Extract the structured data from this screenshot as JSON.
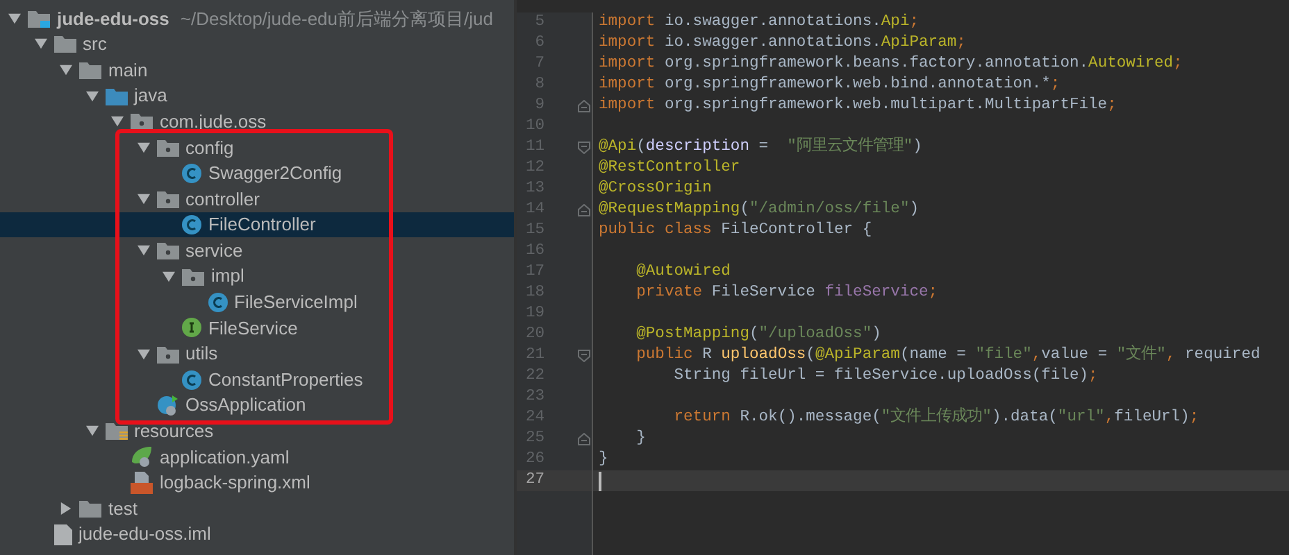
{
  "project_tree": {
    "label": "jude-edu-oss",
    "hint": "~/Desktop/jude-edu前后端分离项目/jud",
    "kind": "module-folder",
    "expanded": true,
    "selected": false,
    "children": [
      {
        "label": "src",
        "kind": "folder",
        "expanded": true,
        "selected": false,
        "children": [
          {
            "label": "main",
            "kind": "folder",
            "expanded": true,
            "selected": false,
            "children": [
              {
                "label": "java",
                "kind": "source-folder",
                "expanded": true,
                "selected": false,
                "children": [
                  {
                    "label": "com.jude.oss",
                    "kind": "package",
                    "expanded": true,
                    "selected": false,
                    "framed": true,
                    "children": [
                      {
                        "label": "config",
                        "kind": "package",
                        "expanded": true,
                        "selected": false,
                        "children": [
                          {
                            "label": "Swagger2Config",
                            "kind": "class",
                            "selected": false
                          }
                        ]
                      },
                      {
                        "label": "controller",
                        "kind": "package",
                        "expanded": true,
                        "selected": false,
                        "children": [
                          {
                            "label": "FileController",
                            "kind": "class",
                            "selected": true
                          }
                        ]
                      },
                      {
                        "label": "service",
                        "kind": "package",
                        "expanded": true,
                        "selected": false,
                        "children": [
                          {
                            "label": "impl",
                            "kind": "package",
                            "expanded": true,
                            "selected": false,
                            "children": [
                              {
                                "label": "FileServiceImpl",
                                "kind": "class",
                                "selected": false
                              }
                            ]
                          },
                          {
                            "label": "FileService",
                            "kind": "interface",
                            "selected": false
                          }
                        ]
                      },
                      {
                        "label": "utils",
                        "kind": "package",
                        "expanded": true,
                        "selected": false,
                        "children": [
                          {
                            "label": "ConstantProperties",
                            "kind": "class",
                            "selected": false
                          }
                        ]
                      },
                      {
                        "label": "OssApplication",
                        "kind": "spring-boot-class",
                        "selected": false
                      }
                    ]
                  }
                ]
              },
              {
                "label": "resources",
                "kind": "resources-folder",
                "expanded": true,
                "selected": false,
                "children": [
                  {
                    "label": "application.yaml",
                    "kind": "yaml",
                    "selected": false
                  },
                  {
                    "label": "logback-spring.xml",
                    "kind": "xml",
                    "selected": false
                  }
                ]
              }
            ]
          },
          {
            "label": "test",
            "kind": "folder",
            "expanded": false,
            "selected": false
          }
        ]
      },
      {
        "label": "jude-edu-oss.iml",
        "kind": "iml-file",
        "selected": false
      }
    ]
  },
  "editor": {
    "lines": [
      {
        "number": "5",
        "kind": "plain",
        "current": false,
        "tokens": [
          {
            "kind": "keyword",
            "text": "import"
          },
          {
            "kind": "plain",
            "text": " io.swagger.annotations."
          },
          {
            "kind": "annotation",
            "text": "Api"
          },
          {
            "kind": "keyword",
            "text": ";"
          }
        ]
      },
      {
        "number": "6",
        "kind": "plain",
        "current": false,
        "tokens": [
          {
            "kind": "keyword",
            "text": "import"
          },
          {
            "kind": "plain",
            "text": " io.swagger.annotations."
          },
          {
            "kind": "annotation",
            "text": "ApiParam"
          },
          {
            "kind": "keyword",
            "text": ";"
          }
        ]
      },
      {
        "number": "7",
        "kind": "plain",
        "current": false,
        "tokens": [
          {
            "kind": "keyword",
            "text": "import"
          },
          {
            "kind": "plain",
            "text": " org.springframework.beans.factory.annotation."
          },
          {
            "kind": "annotation",
            "text": "Autowired"
          },
          {
            "kind": "keyword",
            "text": ";"
          }
        ]
      },
      {
        "number": "8",
        "kind": "plain",
        "current": false,
        "tokens": [
          {
            "kind": "keyword",
            "text": "import"
          },
          {
            "kind": "plain",
            "text": " org.springframework.web.bind.annotation.*"
          },
          {
            "kind": "keyword",
            "text": ";"
          }
        ]
      },
      {
        "number": "9",
        "kind": "fold-end",
        "current": false,
        "tokens": [
          {
            "kind": "keyword",
            "text": "import"
          },
          {
            "kind": "plain",
            "text": " org.springframework.web.multipart.MultipartFile"
          },
          {
            "kind": "keyword",
            "text": ";"
          }
        ]
      },
      {
        "number": "10",
        "kind": "plain",
        "current": false
      },
      {
        "number": "11",
        "kind": "fold-start",
        "current": false,
        "tokens": [
          {
            "kind": "annotation",
            "text": "@Api"
          },
          {
            "kind": "plain",
            "text": "("
          },
          {
            "kind": "param",
            "text": "description"
          },
          {
            "kind": "plain",
            "text": " =  "
          },
          {
            "kind": "string",
            "text": "\"阿里云文件管理\""
          },
          {
            "kind": "plain",
            "text": ")"
          }
        ]
      },
      {
        "number": "12",
        "kind": "plain",
        "current": false,
        "tokens": [
          {
            "kind": "annotation",
            "text": "@RestController"
          }
        ]
      },
      {
        "number": "13",
        "kind": "plain",
        "current": false,
        "tokens": [
          {
            "kind": "annotation",
            "text": "@CrossOrigin"
          }
        ]
      },
      {
        "number": "14",
        "kind": "fold-end",
        "current": false,
        "tokens": [
          {
            "kind": "annotation",
            "text": "@RequestMapping"
          },
          {
            "kind": "plain",
            "text": "("
          },
          {
            "kind": "string",
            "text": "\"/admin/oss/file\""
          },
          {
            "kind": "plain",
            "text": ")"
          }
        ]
      },
      {
        "number": "15",
        "kind": "plain",
        "current": false,
        "tokens": [
          {
            "kind": "keyword",
            "text": "public class"
          },
          {
            "kind": "plain",
            "text": " FileController {"
          }
        ]
      },
      {
        "number": "16",
        "kind": "plain",
        "current": false
      },
      {
        "number": "17",
        "kind": "plain",
        "current": false,
        "tokens": [
          {
            "kind": "annotation",
            "text": "    @Autowired"
          }
        ]
      },
      {
        "number": "18",
        "kind": "plain",
        "current": false,
        "tokens": [
          {
            "kind": "keyword",
            "text": "    private"
          },
          {
            "kind": "plain",
            "text": " FileService "
          },
          {
            "kind": "field",
            "text": "fileService"
          },
          {
            "kind": "keyword",
            "text": ";"
          }
        ]
      },
      {
        "number": "19",
        "kind": "plain",
        "current": false
      },
      {
        "number": "20",
        "kind": "plain",
        "current": false,
        "tokens": [
          {
            "kind": "annotation",
            "text": "    @PostMapping"
          },
          {
            "kind": "plain",
            "text": "("
          },
          {
            "kind": "string",
            "text": "\"/uploadOss\""
          },
          {
            "kind": "plain",
            "text": ")"
          }
        ]
      },
      {
        "number": "21",
        "kind": "fold-start",
        "current": false,
        "tokens": [
          {
            "kind": "keyword",
            "text": "    public"
          },
          {
            "kind": "plain",
            "text": " R "
          },
          {
            "kind": "method",
            "text": "uploadOss"
          },
          {
            "kind": "plain",
            "text": "("
          },
          {
            "kind": "annotation",
            "text": "@ApiParam"
          },
          {
            "kind": "plain",
            "text": "(name = "
          },
          {
            "kind": "string",
            "text": "\"file\""
          },
          {
            "kind": "keyword",
            "text": ","
          },
          {
            "kind": "plain",
            "text": "value = "
          },
          {
            "kind": "string",
            "text": "\"文件\""
          },
          {
            "kind": "keyword",
            "text": ","
          },
          {
            "kind": "plain",
            "text": " required"
          }
        ]
      },
      {
        "number": "22",
        "kind": "plain",
        "current": false,
        "tokens": [
          {
            "kind": "plain",
            "text": "        String fileUrl = fileService.uploadOss(file)"
          },
          {
            "kind": "keyword",
            "text": ";"
          }
        ]
      },
      {
        "number": "23",
        "kind": "plain",
        "current": false
      },
      {
        "number": "24",
        "kind": "plain",
        "current": false,
        "tokens": [
          {
            "kind": "keyword",
            "text": "        return"
          },
          {
            "kind": "plain",
            "text": " R.ok().message("
          },
          {
            "kind": "string",
            "text": "\"文件上传成功\""
          },
          {
            "kind": "plain",
            "text": ").data("
          },
          {
            "kind": "string",
            "text": "\"url\""
          },
          {
            "kind": "keyword",
            "text": ","
          },
          {
            "kind": "plain",
            "text": "fileUrl)"
          },
          {
            "kind": "keyword",
            "text": ";"
          }
        ]
      },
      {
        "number": "25",
        "kind": "fold-end",
        "current": false,
        "tokens": [
          {
            "kind": "plain",
            "text": "    }"
          }
        ]
      },
      {
        "number": "26",
        "kind": "plain",
        "current": false,
        "tokens": [
          {
            "kind": "plain",
            "text": "}"
          }
        ]
      },
      {
        "number": "27",
        "kind": "plain",
        "current": true
      }
    ]
  }
}
